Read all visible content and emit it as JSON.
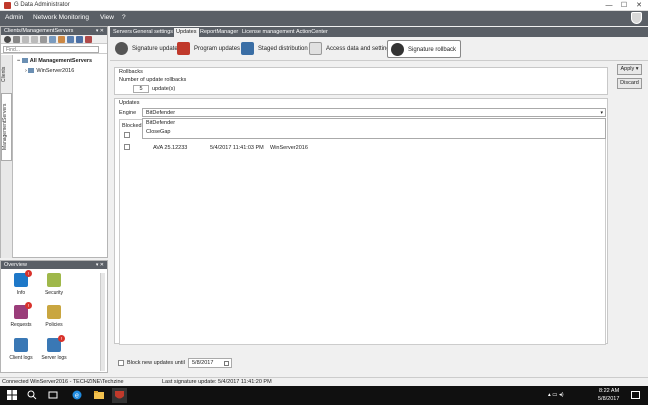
{
  "window": {
    "title": "G Data Administrator",
    "min": "—",
    "max": "☐",
    "close": "✕"
  },
  "menu": {
    "items": [
      "Admin",
      "Network Monitoring",
      "View",
      "?"
    ]
  },
  "left": {
    "header": "Clients/ManagementServers",
    "pin": "▾ ✕",
    "find_placeholder": "Find...",
    "tabs": [
      "Clients",
      "ManagementServers"
    ],
    "tree": {
      "root": "All ManagementServers",
      "child": "WinServer2016"
    }
  },
  "overview": {
    "header": "Overview",
    "pin": "▾ ✕",
    "items": [
      {
        "label": "Info",
        "badge": "!"
      },
      {
        "label": "Security",
        "badge": ""
      },
      {
        "label": "Requests",
        "badge": "!"
      },
      {
        "label": "Policies",
        "badge": ""
      },
      {
        "label": "Client logs",
        "badge": ""
      },
      {
        "label": "Server logs",
        "badge": "!"
      }
    ]
  },
  "tabs": [
    "Servers",
    "General settings",
    "Updates",
    "ReportManager",
    "License management",
    "ActionCenter"
  ],
  "toolbar": {
    "buttons": [
      "Signature updates",
      "Program updates",
      "Staged distribution",
      "Access data and settings",
      "Signature rollback"
    ]
  },
  "rollbacks": {
    "title": "Rollbacks",
    "count_label": "Number of update rollbacks",
    "count_value": "5",
    "unit": "update(s)"
  },
  "updates": {
    "title": "Updates",
    "engine_label": "Engine",
    "engine_value": "BitDefender",
    "engine_options": [
      "BitDefender",
      "CloseGap"
    ],
    "column_blocked": "Blocked",
    "row": {
      "version": "AVA 25.12233",
      "date": "5/4/2017 11:41:03 PM",
      "server": "WinServer2016"
    }
  },
  "block": {
    "label": "Block new updates until",
    "date": "5/8/2017",
    "icon": "calendar-icon"
  },
  "actions": {
    "apply": "Apply",
    "apply_arrow": "▾",
    "discard": "Discard"
  },
  "status": {
    "connected": "Connected WinServer2016 - TECHZINE\\Techzine",
    "last_update": "Last signature update: 5/4/2017 11:41:20 PM"
  },
  "taskbar": {
    "time": "8:22 AM",
    "date": "5/8/2017"
  }
}
